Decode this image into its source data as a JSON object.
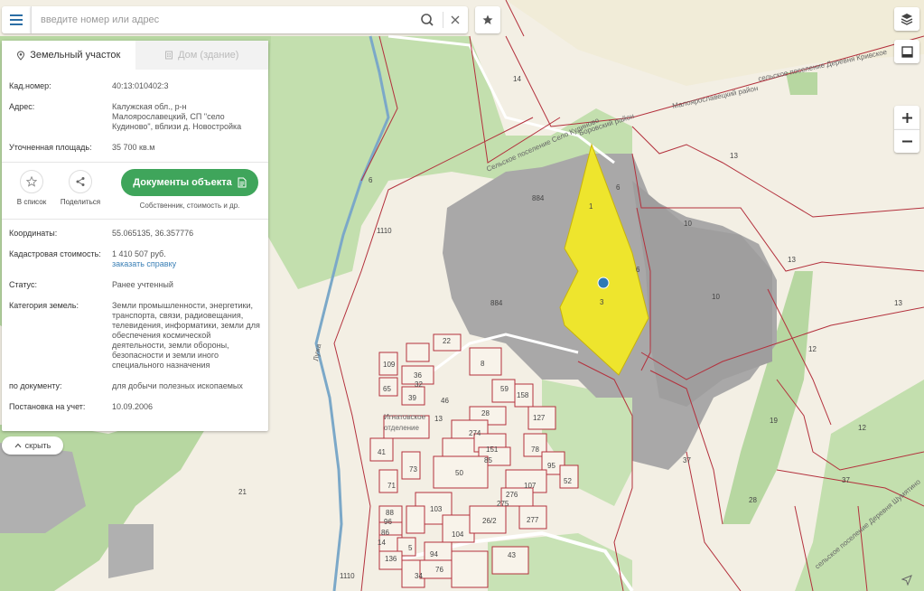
{
  "search": {
    "placeholder": "введите номер или адрес"
  },
  "tabs": [
    {
      "label": "Земельный участок",
      "active": true
    },
    {
      "label": "Дом (здание)",
      "active": false
    }
  ],
  "parcel": {
    "cad_label": "Кад.номер:",
    "cad_value": "40:13:010402:3",
    "address_label": "Адрес:",
    "address_value": "Калужская обл., р-н Малоярославецкий, СП \"село Кудиново\", вблизи д. Новостройка",
    "area_label": "Уточненная площадь:",
    "area_value": "35 700 кв.м"
  },
  "actions": {
    "favorite_label": "В список",
    "share_label": "Поделиться",
    "documents_label": "Документы объекта",
    "documents_sub": "Собственник, стоимость и др."
  },
  "details": {
    "coords_label": "Координаты:",
    "coords_value": "55.065135, 36.357776",
    "cost_label": "Кадастровая стоимость:",
    "cost_value": "1 410 507 руб.",
    "cost_link": "заказать справку",
    "status_label": "Статус:",
    "status_value": "Ранее учтенный",
    "category_label": "Категория земель:",
    "category_value": "Земли промышленности, энергетики, транспорта, связи, радиовещания, телевидения, информатики, земли для обеспечения космической деятельности, земли обороны, безопасности и земли иного специального назначения",
    "bydoc_label": "по документу:",
    "bydoc_value": "для добычи полезных ископаемых",
    "registered_label": "Постановка на учет:",
    "registered_value": "10.09.2006"
  },
  "collapse_label": "скрыть",
  "map": {
    "parcel_labels": [
      "14",
      "13",
      "13",
      "12",
      "12",
      "1",
      "37",
      "19",
      "28",
      "21",
      "1110",
      "1110",
      "884",
      "884",
      "6",
      "6",
      "6",
      "10",
      "10",
      "3",
      "1",
      "22",
      "8",
      "59",
      "127",
      "36",
      "65",
      "39",
      "28",
      "46",
      "274",
      "151",
      "85",
      "78",
      "95",
      "52",
      "50",
      "107",
      "276",
      "275",
      "277",
      "103",
      "104",
      "26/2",
      "43",
      "94",
      "76",
      "136",
      "34",
      "88",
      "96",
      "86",
      "14",
      "5",
      "71",
      "73",
      "41",
      "109",
      "32",
      "13"
    ],
    "place_labels": {
      "settlement": "Игнатовское отделение",
      "road1": "сельское поселение Деревня Кривское",
      "road2": "Малоярославецкий район",
      "road3": "Сельское поселение Село Кудиново",
      "road4": "Боровский район",
      "road5": "сельское поселение Деревня Шумятино",
      "river": "Лужа"
    }
  },
  "colors": {
    "accent_green": "#3fa55b",
    "parcel_highlight": "#f2e927",
    "boundary": "#b3303c",
    "forest": "#b7d7a1",
    "quarry": "#a9a8a8"
  }
}
